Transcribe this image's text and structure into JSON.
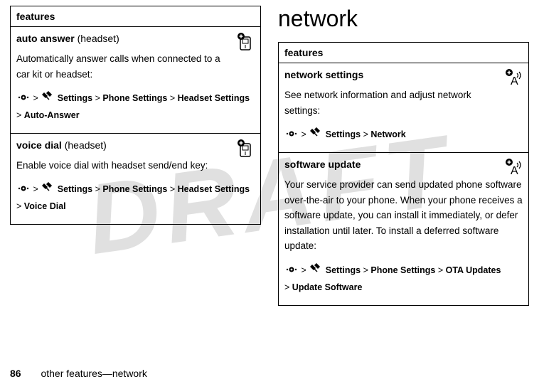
{
  "watermark": "DRAFT",
  "left": {
    "header": "features",
    "rows": [
      {
        "title_bold": "auto answer",
        "title_paren": "(headset)",
        "icon": "headset-plus-icon",
        "desc": "Automatically answer calls when connected to a car kit or headset:",
        "path_segments": [
          "Settings",
          "Phone Settings",
          "Headset Settings",
          "Auto-Answer"
        ]
      },
      {
        "title_bold": "voice dial",
        "title_paren": "(headset)",
        "icon": "headset-plus-icon",
        "desc": "Enable voice dial with headset send/end key:",
        "path_segments": [
          "Settings",
          "Phone Settings",
          "Headset Settings",
          "Voice Dial"
        ]
      }
    ]
  },
  "right": {
    "section_heading": "network",
    "header": "features",
    "rows": [
      {
        "title_bold": "network settings",
        "icon": "antenna-plus-icon",
        "desc": "See network information and adjust network settings:",
        "path_segments": [
          "Settings",
          "Network"
        ]
      },
      {
        "title_bold": "software update",
        "icon": "antenna-plus-icon",
        "desc": "Your service provider can send updated phone software over-the-air to your phone. When your phone receives a software update, you can install it immediately, or defer installation until later. To install a deferred software update:",
        "path_segments": [
          "Settings",
          "Phone Settings",
          "OTA Updates",
          "Update Software"
        ]
      }
    ]
  },
  "gt": ">",
  "footer": {
    "page_number": "86",
    "text": "other features—network"
  }
}
